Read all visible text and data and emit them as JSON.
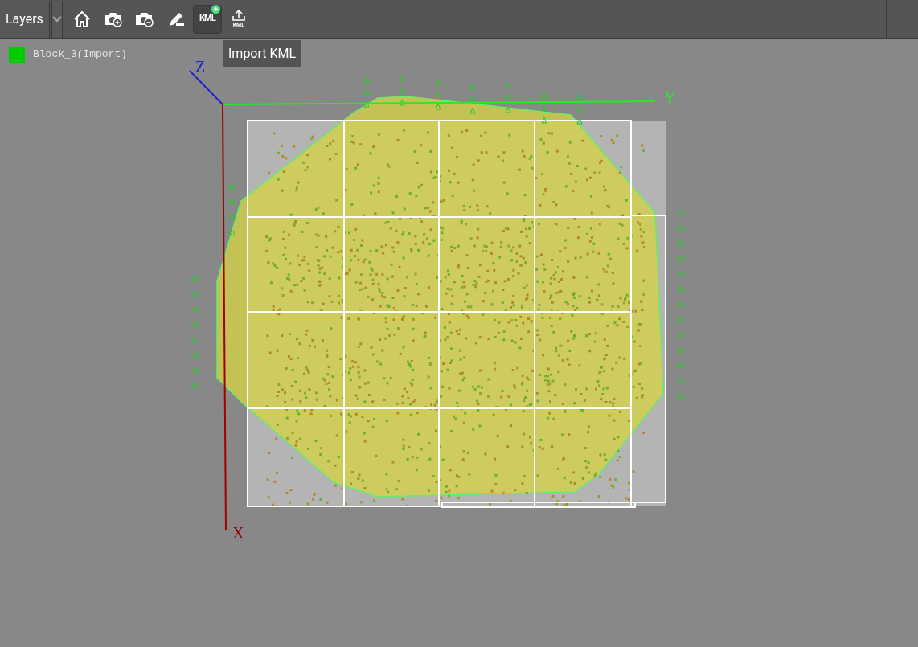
{
  "toolbar": {
    "layers_dropdown": {
      "label": "Layers"
    },
    "tools": [
      {
        "kind": "home",
        "selected": false
      },
      {
        "kind": "zoom_in",
        "selected": false
      },
      {
        "kind": "zoom_out",
        "selected": false
      },
      {
        "kind": "edit",
        "selected": false
      },
      {
        "kind": "import_kml",
        "label": "KML",
        "selected": true
      },
      {
        "kind": "export_kml",
        "label": "KML",
        "selected": false
      }
    ]
  },
  "tooltip": {
    "text": "Import KML"
  },
  "legend": [
    {
      "name": "Block_3(Import)",
      "color": "#00cc00"
    }
  ],
  "axes": [
    {
      "label": "Z",
      "color": "#2222cc"
    },
    {
      "label": "Y",
      "color": "#22ee22"
    },
    {
      "label": "X",
      "color": "#a00000"
    }
  ]
}
